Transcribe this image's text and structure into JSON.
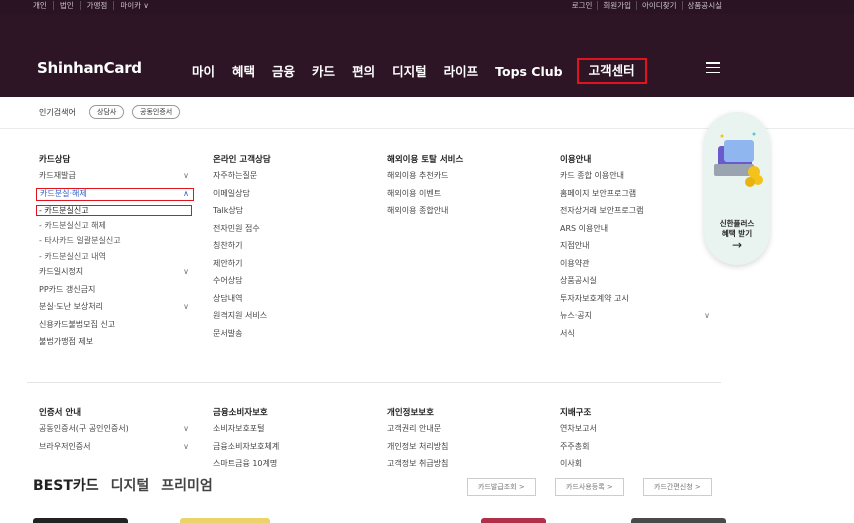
{
  "topbar": {
    "left": [
      "개인",
      "법인",
      "가맹점",
      "마이카 ∨"
    ],
    "right": [
      "로그인",
      "회원가입",
      "아이디찾기",
      "상품공시실"
    ]
  },
  "header": {
    "logo": "ShinhanCard",
    "nav": [
      "마이",
      "혜택",
      "금융",
      "카드",
      "편의",
      "디지털",
      "라이프",
      "Tops Club",
      "고객센터"
    ],
    "menu_icon": "hamburger-icon"
  },
  "popular": {
    "label": "인기검색어",
    "chips": [
      "상담사",
      "공동인증서"
    ]
  },
  "mega": {
    "columns": [
      {
        "title": "카드상담",
        "items": [
          {
            "label": "카드재발급",
            "chev": "∨"
          },
          {
            "label": "카드분실·해제",
            "chev": "∧"
          }
        ],
        "subs": [
          "- 카드분실신고",
          "- 카드분실신고 해제",
          "- 타사카드 일괄분실신고",
          "- 카드분실신고 내역"
        ],
        "more": [
          {
            "label": "카드일시정지",
            "chev": "∨"
          },
          {
            "label": "PP카드 갱신금지",
            "chev": ""
          },
          {
            "label": "분실·도난 보상처리",
            "chev": "∨"
          },
          {
            "label": "신용카드불법모집 신고",
            "chev": ""
          },
          {
            "label": "불법가맹점 제보",
            "chev": ""
          }
        ]
      },
      {
        "title": "온라인 고객상담",
        "items": [
          "자주하는질문",
          "이메일상담",
          "Talk상담",
          "전자민원 접수",
          "칭찬하기",
          "제안하기",
          "수어상담",
          "상담내역",
          "원격지원 서비스",
          "문서발송"
        ]
      },
      {
        "title": "해외이용 토탈 서비스",
        "items": [
          "해외이용 추천카드",
          "해외이용 이벤트",
          "해외이용 종합안내"
        ]
      },
      {
        "title": "이용안내",
        "items": [
          "카드 종합 이용안내",
          "홈페이지 보안프로그램",
          "전자상거래 보안프로그램",
          "ARS 이용안내",
          "지점안내",
          "이용약관",
          "상품공시실",
          "투자자보호계약 고시",
          "뉴스·공지",
          "서식"
        ]
      }
    ],
    "row2": [
      {
        "title": "인증서 안내",
        "items": [
          {
            "label": "공동인증서(구 공인인증서)",
            "chev": "∨"
          },
          {
            "label": "브라우저인증서",
            "chev": "∨"
          }
        ]
      },
      {
        "title": "금융소비자보호",
        "items": [
          "소비자보호포털",
          "금융소비자보호체계",
          "스마트금융 10계명"
        ]
      },
      {
        "title": "개인정보보호",
        "items": [
          "고객권리 안내문",
          "개인정보 처리방침",
          "고객정보 취급방침"
        ]
      },
      {
        "title": "지배구조",
        "items": [
          "연차보고서",
          "주주총회",
          "이사회"
        ]
      }
    ]
  },
  "promo": {
    "line1": "신한플러스",
    "line2": "혜택 받기",
    "arrow": "→"
  },
  "behind": {
    "tabs": [
      "BEST카드",
      "디지털",
      "프리미엄"
    ],
    "pills": [
      "카드발급조회 >",
      "카드사용등록 >",
      "카드간편신청 >"
    ]
  }
}
